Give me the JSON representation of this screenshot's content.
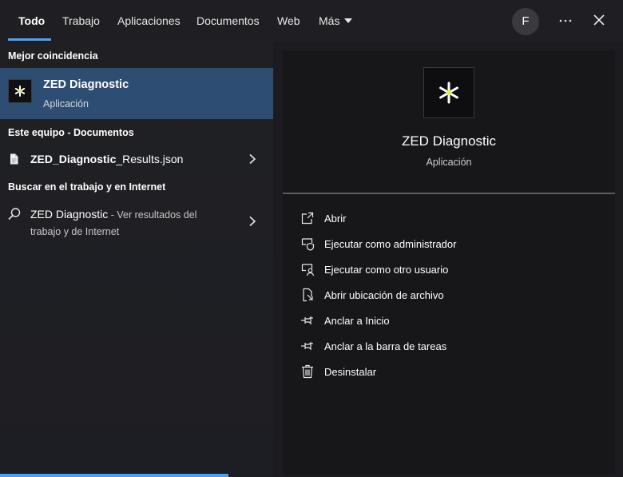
{
  "tabs": [
    {
      "label": "Todo",
      "active": true
    },
    {
      "label": "Trabajo"
    },
    {
      "label": "Aplicaciones"
    },
    {
      "label": "Documentos"
    },
    {
      "label": "Web"
    },
    {
      "label": "Más"
    }
  ],
  "header": {
    "avatar_initial": "F",
    "more_icon": "more-horizontal-icon",
    "close_icon": "close-icon"
  },
  "left": {
    "best_match_title": "Mejor coincidencia",
    "best_match": {
      "name": "ZED Diagnostic",
      "type": "Aplicación"
    },
    "documents_title": "Este equipo - Documentos",
    "document": {
      "name_bold": "ZED_Diagnostic",
      "name_rest": "_Results.json"
    },
    "web_title": "Buscar en el trabajo y en Internet",
    "web_result": {
      "query": "ZED Diagnostic",
      "suffix": " - Ver resultados del",
      "line2": "trabajo y de Internet"
    }
  },
  "detail": {
    "name": "ZED Diagnostic",
    "type": "Aplicación",
    "actions": [
      {
        "label": "Abrir",
        "icon": "open-icon"
      },
      {
        "label": "Ejecutar como administrador",
        "icon": "shield-admin-icon"
      },
      {
        "label": "Ejecutar como otro usuario",
        "icon": "user-switch-icon"
      },
      {
        "label": "Abrir ubicación de archivo",
        "icon": "file-location-icon"
      },
      {
        "label": "Anclar a Inicio",
        "icon": "pin-icon"
      },
      {
        "label": "Anclar a la barra de tareas",
        "icon": "pin-icon"
      },
      {
        "label": "Desinstalar",
        "icon": "trash-icon"
      }
    ]
  },
  "colors": {
    "accent": "#4aa0ff",
    "selection": "#2d4e72",
    "app_icon_dot": "#e6f04a"
  }
}
